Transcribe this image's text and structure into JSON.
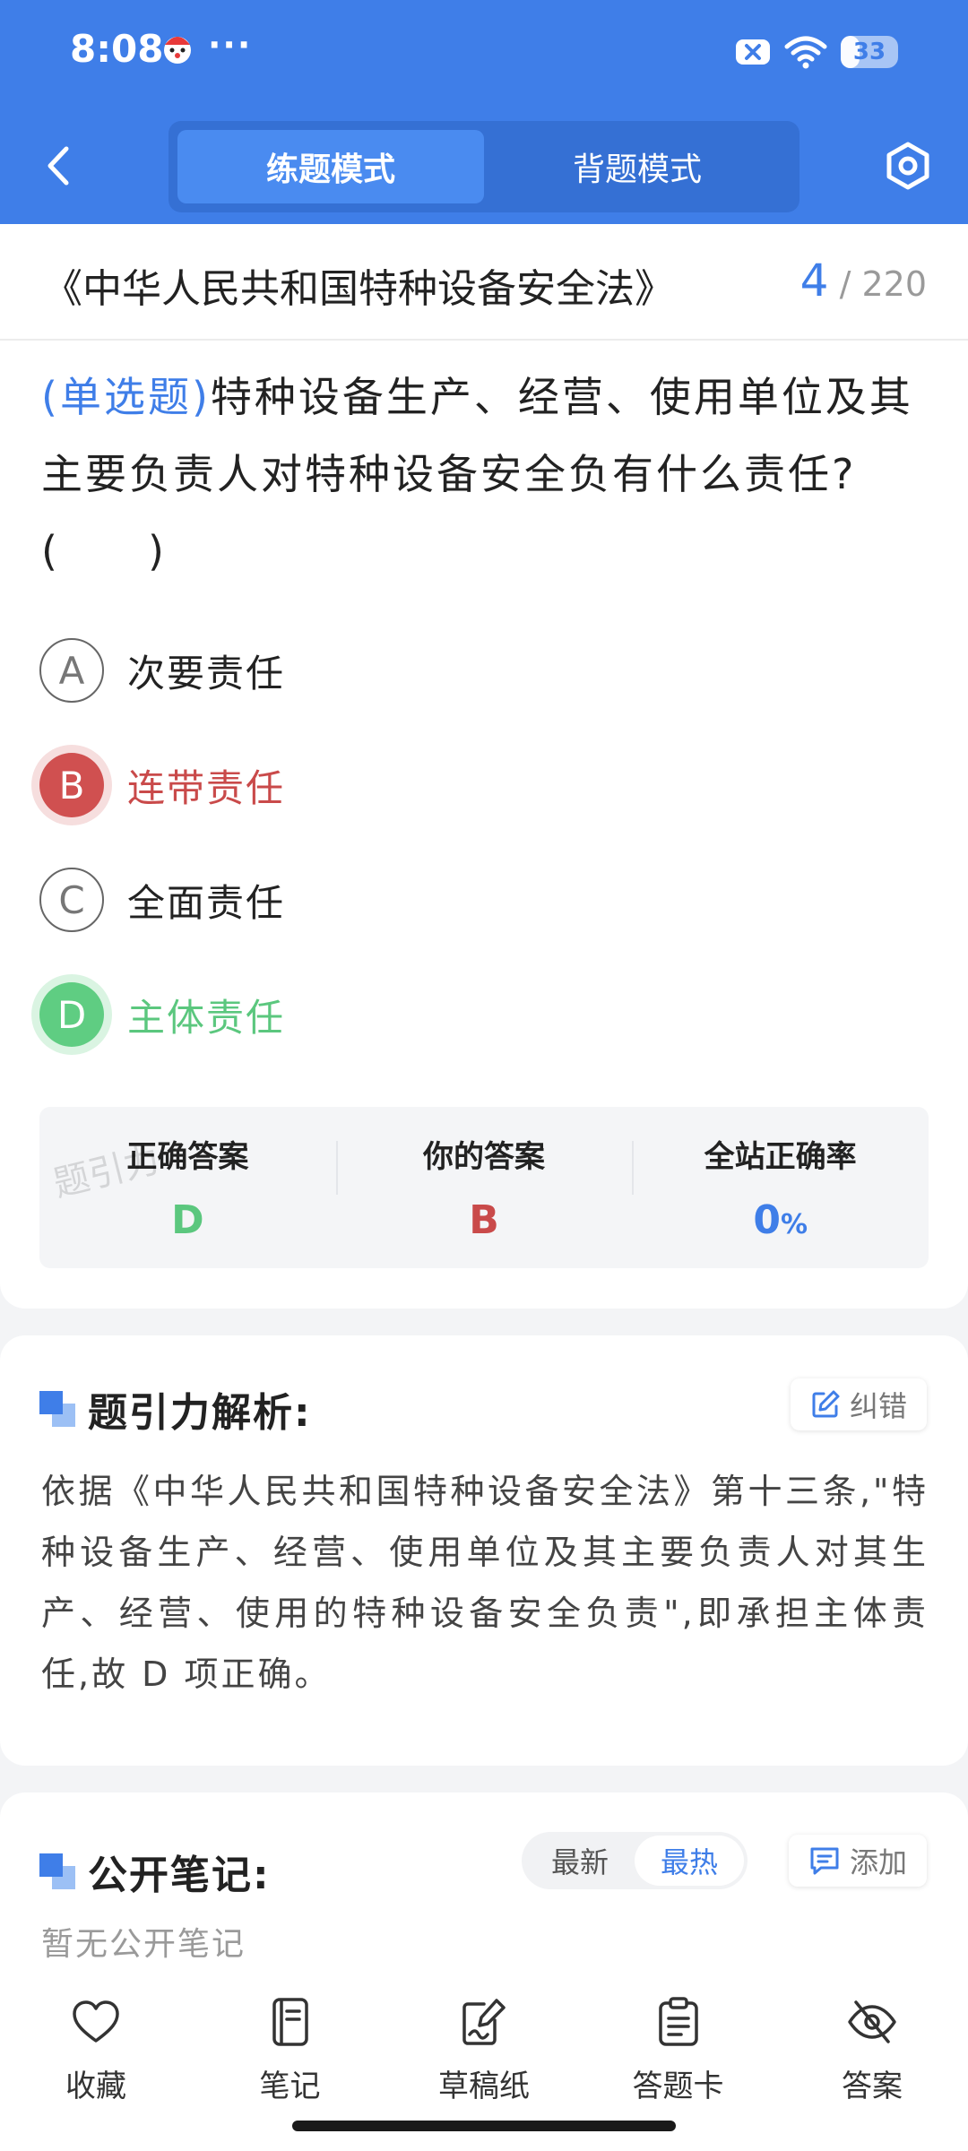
{
  "status_bar": {
    "time": "8:08",
    "more": "···",
    "battery": "33",
    "battery_level_percent": 33
  },
  "header": {
    "modes": [
      {
        "label": "练题模式",
        "active": true
      },
      {
        "label": "背题模式",
        "active": false
      }
    ],
    "accent_color": "#3f7ee8"
  },
  "chapter": {
    "title": "《中华人民共和国特种设备安全法》",
    "current": "4",
    "separator": "/",
    "total": "220"
  },
  "question": {
    "type": "(单选题)",
    "text": "特种设备生产、经营、使用单位及其主要负责人对特种设备安全负有什么责任?(　　)",
    "options": [
      {
        "letter": "A",
        "text": "次要责任",
        "state": "normal"
      },
      {
        "letter": "B",
        "text": "连带责任",
        "state": "wrong"
      },
      {
        "letter": "C",
        "text": "全面责任",
        "state": "normal"
      },
      {
        "letter": "D",
        "text": "主体责任",
        "state": "right"
      }
    ]
  },
  "answer_summary": {
    "correct_label": "正确答案",
    "correct_value": "D",
    "mine_label": "你的答案",
    "mine_value": "B",
    "rate_label": "全站正确率",
    "rate_value": "0",
    "rate_unit": "%",
    "watermark": "题引力"
  },
  "analysis": {
    "title": "题引力解析:",
    "report_label": "纠错",
    "text": "依据《中华人民共和国特种设备安全法》第十三条,\"特种设备生产、经营、使用单位及其主要负责人对其生产、经营、使用的特种设备安全负责\",即承担主体责任,故 D 项正确。"
  },
  "notes": {
    "title": "公开笔记:",
    "sort_newest": "最新",
    "sort_hottest": "最热",
    "add_label": "添加",
    "empty_text": "暂无公开笔记"
  },
  "bottom_nav": [
    {
      "label": "收藏",
      "icon": "heart-icon"
    },
    {
      "label": "笔记",
      "icon": "notebook-icon"
    },
    {
      "label": "草稿纸",
      "icon": "draft-icon"
    },
    {
      "label": "答题卡",
      "icon": "answer-sheet-icon"
    },
    {
      "label": "答案",
      "icon": "eye-off-icon"
    }
  ]
}
